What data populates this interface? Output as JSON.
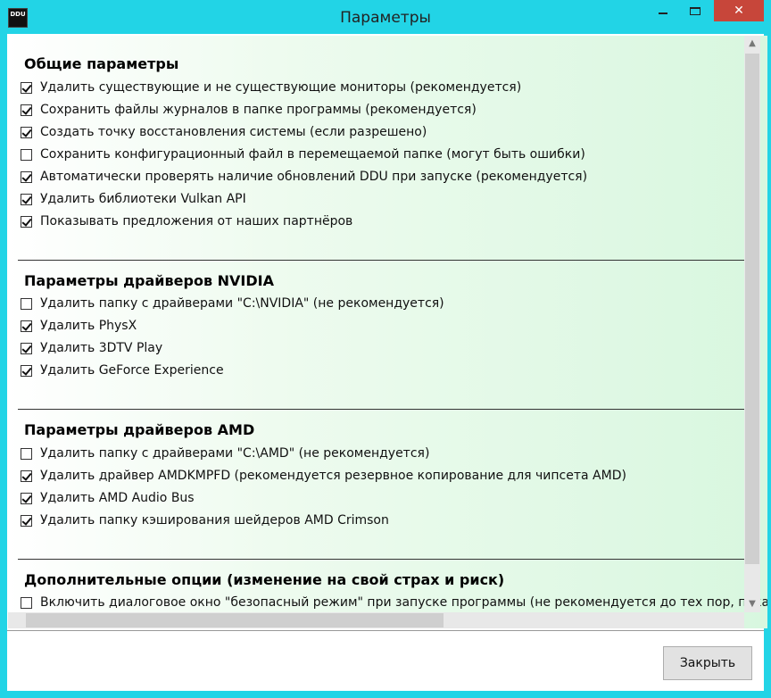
{
  "window": {
    "title": "Параметры",
    "icon_text": "DDU",
    "close_glyph": "✕"
  },
  "sections": {
    "general": {
      "title": "Общие параметры",
      "options": [
        {
          "label": "Удалить существующие и не существующие мониторы (рекомендуется)",
          "checked": true
        },
        {
          "label": "Сохранить файлы журналов в папке программы (рекомендуется)",
          "checked": true
        },
        {
          "label": "Создать точку восстановления системы (если разрешено)",
          "checked": true
        },
        {
          "label": "Сохранить конфигурационный файл в перемещаемой папке (могут быть ошибки)",
          "checked": false
        },
        {
          "label": "Автоматически проверять наличие обновлений DDU при запуске (рекомендуется)",
          "checked": true
        },
        {
          "label": "Удалить библиотеки Vulkan API",
          "checked": true
        },
        {
          "label": "Показывать предложения от наших партнёров",
          "checked": true
        }
      ]
    },
    "nvidia": {
      "title": "Параметры драйверов NVIDIA",
      "options": [
        {
          "label": "Удалить папку с драйверами \"C:\\NVIDIA\" (не рекомендуется)",
          "checked": false
        },
        {
          "label": "Удалить PhysX",
          "checked": true
        },
        {
          "label": "Удалить 3DTV Play",
          "checked": true
        },
        {
          "label": "Удалить GeForce Experience",
          "checked": true
        }
      ]
    },
    "amd": {
      "title": "Параметры драйверов AMD",
      "options": [
        {
          "label": "Удалить папку с драйверами \"C:\\AMD\" (не рекомендуется)",
          "checked": false
        },
        {
          "label": "Удалить драйвер AMDKMPFD (рекомендуется резервное копирование для чипсета AMD)",
          "checked": true
        },
        {
          "label": "Удалить AMD Audio Bus",
          "checked": true
        },
        {
          "label": "Удалить папку кэширования шейдеров AMD Crimson",
          "checked": true
        }
      ]
    },
    "advanced": {
      "title": "Дополнительные опции (изменение на свой страх и риск)",
      "options": [
        {
          "label": "Включить диалоговое окно \"безопасный режим\" при запуске программы (не рекомендуется до тех пор, пока без",
          "checked": false
        }
      ]
    }
  },
  "buttons": {
    "close_label": "Закрыть"
  }
}
